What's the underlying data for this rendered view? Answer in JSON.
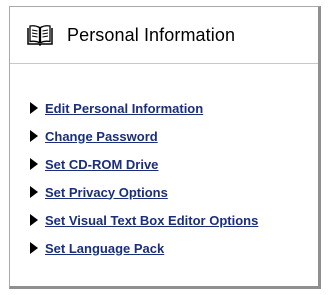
{
  "panel": {
    "title": "Personal Information",
    "title_icon": "book-icon"
  },
  "links": [
    {
      "label": "Edit Personal Information",
      "icon": "arrow-right-icon"
    },
    {
      "label": "Change Password",
      "icon": "arrow-right-icon"
    },
    {
      "label": "Set CD-ROM Drive",
      "icon": "arrow-right-icon"
    },
    {
      "label": "Set Privacy Options",
      "icon": "arrow-right-icon"
    },
    {
      "label": "Set Visual Text Box Editor Options",
      "icon": "arrow-right-icon"
    },
    {
      "label": "Set Language Pack",
      "icon": "arrow-right-icon"
    }
  ],
  "colors": {
    "link": "#1a2e7a",
    "border": "#8f8f8f",
    "background": "#ffffff"
  }
}
